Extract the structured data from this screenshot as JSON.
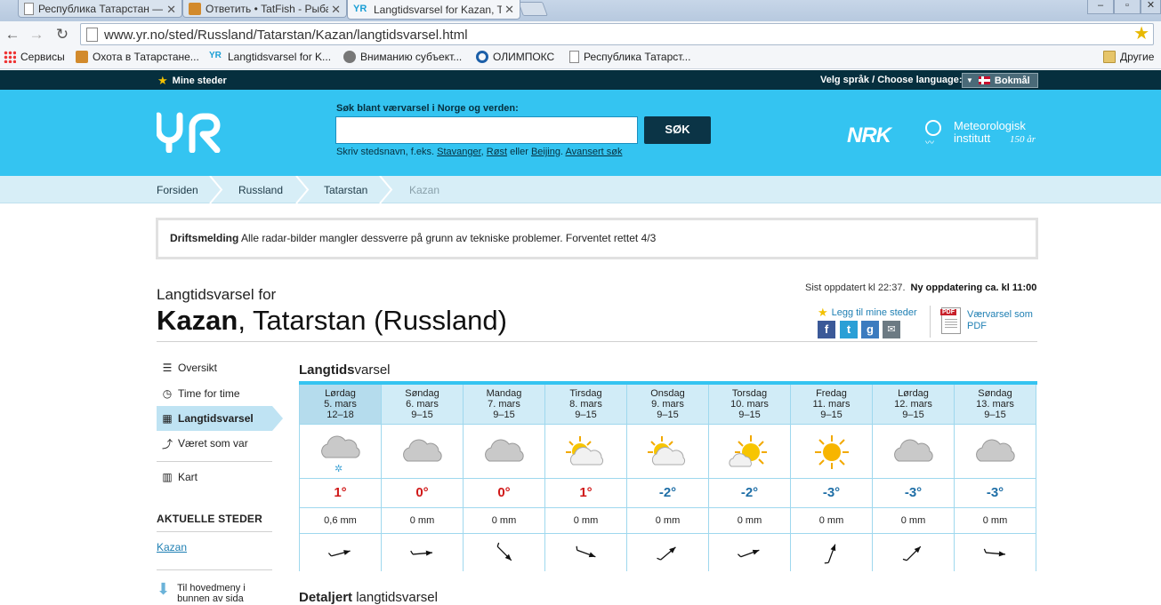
{
  "browser": {
    "tabs": [
      {
        "title": "Республика Татарстан —"
      },
      {
        "title": "Ответить • TatFish - Рыба"
      },
      {
        "title": "Langtidsvarsel for Kazan, T"
      }
    ],
    "url": "www.yr.no/sted/Russland/Tatarstan/Kazan/langtidsvarsel.html",
    "bookmarks": [
      {
        "label": "Сервисы"
      },
      {
        "label": "Охота в Татарстане..."
      },
      {
        "label": "Langtidsvarsel for K..."
      },
      {
        "label": "Вниманию субъект..."
      },
      {
        "label": "ОЛИМПОКС"
      },
      {
        "label": "Республика Татарст..."
      },
      {
        "label": "Другие"
      }
    ]
  },
  "topstrip": {
    "mine_steder": "Mine steder",
    "lang_label": "Velg språk / Choose language:",
    "lang_value": "Bokmål"
  },
  "header": {
    "logo_text": "YR",
    "search_label": "Søk blant værvarsel i Norge og verden:",
    "search_button": "SØK",
    "hint_prefix": "Skriv stedsnavn, f.eks.",
    "hint_link1": "Stavanger",
    "hint_link2": "Røst",
    "hint_or": "eller",
    "hint_link3": "Beijing",
    "hint_link4": "Avansert søk",
    "nrk": "NRK",
    "met_line1": "Meteorologisk",
    "met_line2": "institutt",
    "met_150": "150 år"
  },
  "breadcrumb": [
    "Forsiden",
    "Russland",
    "Tatarstan",
    "Kazan"
  ],
  "notice": {
    "label": "Driftsmelding",
    "text": "Alle radar-bilder mangler dessverre på grunn av tekniske problemer. Forventet rettet 4/3"
  },
  "page": {
    "subtitle": "Langtidsvarsel for",
    "city": "Kazan",
    "region": ", Tatarstan (Russland)",
    "updated": "Sist oppdatert kl 22:37.",
    "next_update": "Ny oppdatering ca. kl 11:00",
    "add_fav": "Legg til mine steder",
    "pdf_line1": "Værvarsel som",
    "pdf_line2": "PDF"
  },
  "sidenav": {
    "items": [
      {
        "label": "Oversikt"
      },
      {
        "label": "Time for time"
      },
      {
        "label": "Langtidsvarsel"
      },
      {
        "label": "Været som var"
      },
      {
        "label": "Kart"
      }
    ],
    "aktuelle": "AKTUELLE STEDER",
    "kazan": "Kazan",
    "til_meny_1": "Til hovedmeny i",
    "til_meny_2": "bunnen av sida"
  },
  "forecast": {
    "title_bold": "Langtids",
    "title_rest": "varsel",
    "days": [
      {
        "day": "Lørdag",
        "date": "5. mars",
        "time": "12–18",
        "icon": "cloud-snow-icon",
        "temp": "1°",
        "prec": "0,6 mm",
        "wind_deg": 255
      },
      {
        "day": "Søndag",
        "date": "6. mars",
        "time": "9–15",
        "icon": "cloud-icon",
        "temp": "0°",
        "prec": "0 mm",
        "wind_deg": 265
      },
      {
        "day": "Mandag",
        "date": "7. mars",
        "time": "9–15",
        "icon": "cloud-icon",
        "temp": "0°",
        "prec": "0 mm",
        "wind_deg": 315
      },
      {
        "day": "Tirsdag",
        "date": "8. mars",
        "time": "9–15",
        "icon": "partly-cloudy-icon",
        "temp": "1°",
        "prec": "0 mm",
        "wind_deg": 290
      },
      {
        "day": "Onsdag",
        "date": "9. mars",
        "time": "9–15",
        "icon": "partly-cloudy-icon",
        "temp": "-2°",
        "prec": "0 mm",
        "wind_deg": 230
      },
      {
        "day": "Torsdag",
        "date": "10. mars",
        "time": "9–15",
        "icon": "sun-cloud-icon",
        "temp": "-2°",
        "prec": "0 mm",
        "wind_deg": 250
      },
      {
        "day": "Fredag",
        "date": "11. mars",
        "time": "9–15",
        "icon": "sun-icon",
        "temp": "-3°",
        "prec": "0 mm",
        "wind_deg": 200
      },
      {
        "day": "Lørdag",
        "date": "12. mars",
        "time": "9–15",
        "icon": "cloud-icon",
        "temp": "-3°",
        "prec": "0 mm",
        "wind_deg": 225
      },
      {
        "day": "Søndag",
        "date": "13. mars",
        "time": "9–15",
        "icon": "cloud-icon",
        "temp": "-3°",
        "prec": "0 mm",
        "wind_deg": 275
      }
    ]
  },
  "detaljert": {
    "bold": "Detaljert",
    "rest": " langtidsvarsel"
  },
  "colors": {
    "brand": "#34c4f1",
    "dark": "#062f3e",
    "warm": "#d01818",
    "cold": "#1e6ea6"
  }
}
